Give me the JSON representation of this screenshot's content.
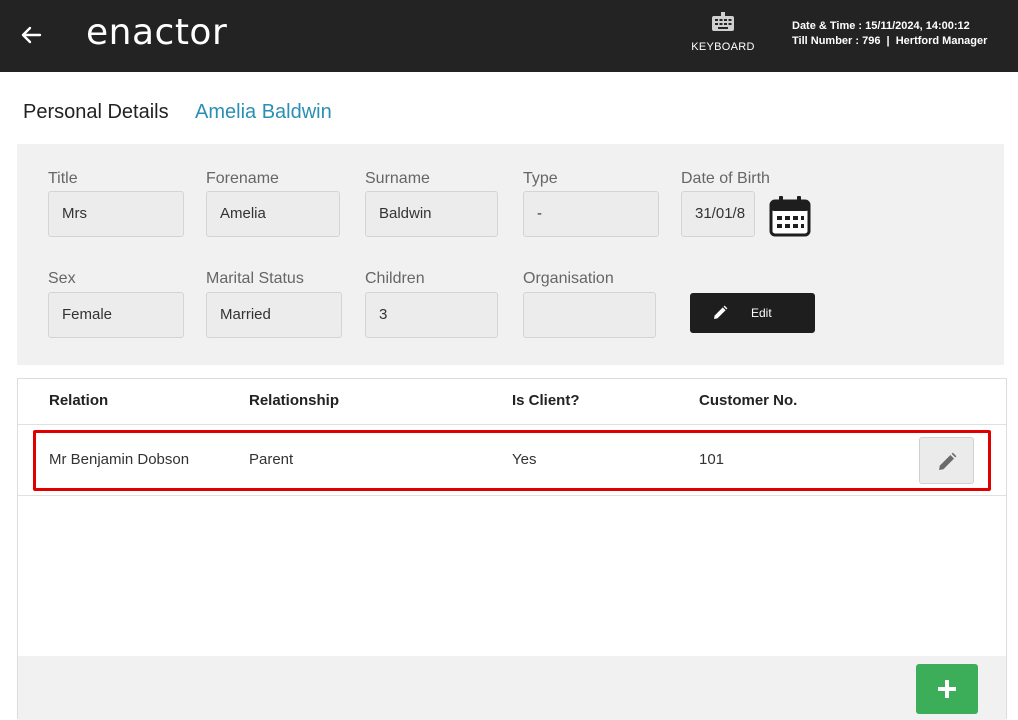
{
  "header": {
    "logo_text": "enactor",
    "keyboard_label": "KEYBOARD",
    "datetime_line": "Date & Time : 15/11/2024, 14:00:12",
    "till_line": "Till Number : 796  |  Hertford Manager"
  },
  "page": {
    "title": "Personal Details",
    "customer_name": "Amelia Baldwin"
  },
  "fields": {
    "title": {
      "label": "Title",
      "value": "Mrs"
    },
    "forename": {
      "label": "Forename",
      "value": "Amelia"
    },
    "surname": {
      "label": "Surname",
      "value": "Baldwin"
    },
    "type": {
      "label": "Type",
      "value": "-"
    },
    "dob": {
      "label": "Date of Birth",
      "value": "31/01/8"
    },
    "sex": {
      "label": "Sex",
      "value": "Female"
    },
    "marital": {
      "label": "Marital Status",
      "value": "Married"
    },
    "children": {
      "label": "Children",
      "value": "3"
    },
    "organisation": {
      "label": "Organisation",
      "value": ""
    }
  },
  "edit_button": {
    "label": "Edit"
  },
  "relations": {
    "headers": [
      "Relation",
      "Relationship",
      "Is Client?",
      "Customer No."
    ],
    "rows": [
      {
        "relation": "Mr Benjamin Dobson",
        "relationship": "Parent",
        "is_client": "Yes",
        "customer_no": "101"
      }
    ]
  },
  "colors": {
    "accent": "#2a8fb5",
    "header_bg": "#232323",
    "add_green": "#3cae5a",
    "highlight": "#e00000"
  }
}
